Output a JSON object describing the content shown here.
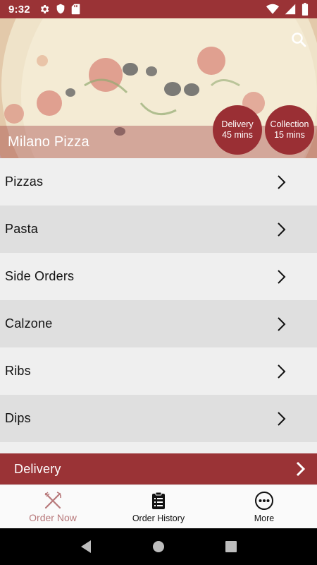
{
  "status_bar": {
    "time": "9:32",
    "left_icons": [
      "settings-icon",
      "shield-icon",
      "sd-card-icon"
    ],
    "right_icons": [
      "wifi-icon",
      "signal-icon",
      "battery-icon"
    ]
  },
  "hero": {
    "title": "Milano Pizza",
    "search_icon": "search-icon",
    "delivery_badge": {
      "label": "Delivery",
      "time": "45 mins"
    },
    "collection_badge": {
      "label": "Collection",
      "time": "15 mins"
    }
  },
  "categories": [
    {
      "label": "Pizzas"
    },
    {
      "label": "Pasta"
    },
    {
      "label": "Side Orders"
    },
    {
      "label": "Calzone"
    },
    {
      "label": "Ribs"
    },
    {
      "label": "Dips"
    }
  ],
  "delivery_bar": {
    "label": "Delivery"
  },
  "bottom_nav": {
    "items": [
      {
        "label": "Order Now",
        "icon": "fork-knife-icon",
        "active": true
      },
      {
        "label": "Order History",
        "icon": "clipboard-icon",
        "active": false
      },
      {
        "label": "More",
        "icon": "more-icon",
        "active": false
      }
    ]
  },
  "colors": {
    "brand": "#9a3336",
    "active_nav": "#b8797b",
    "row_light": "#efefef",
    "row_dark": "#dfdfdf"
  }
}
